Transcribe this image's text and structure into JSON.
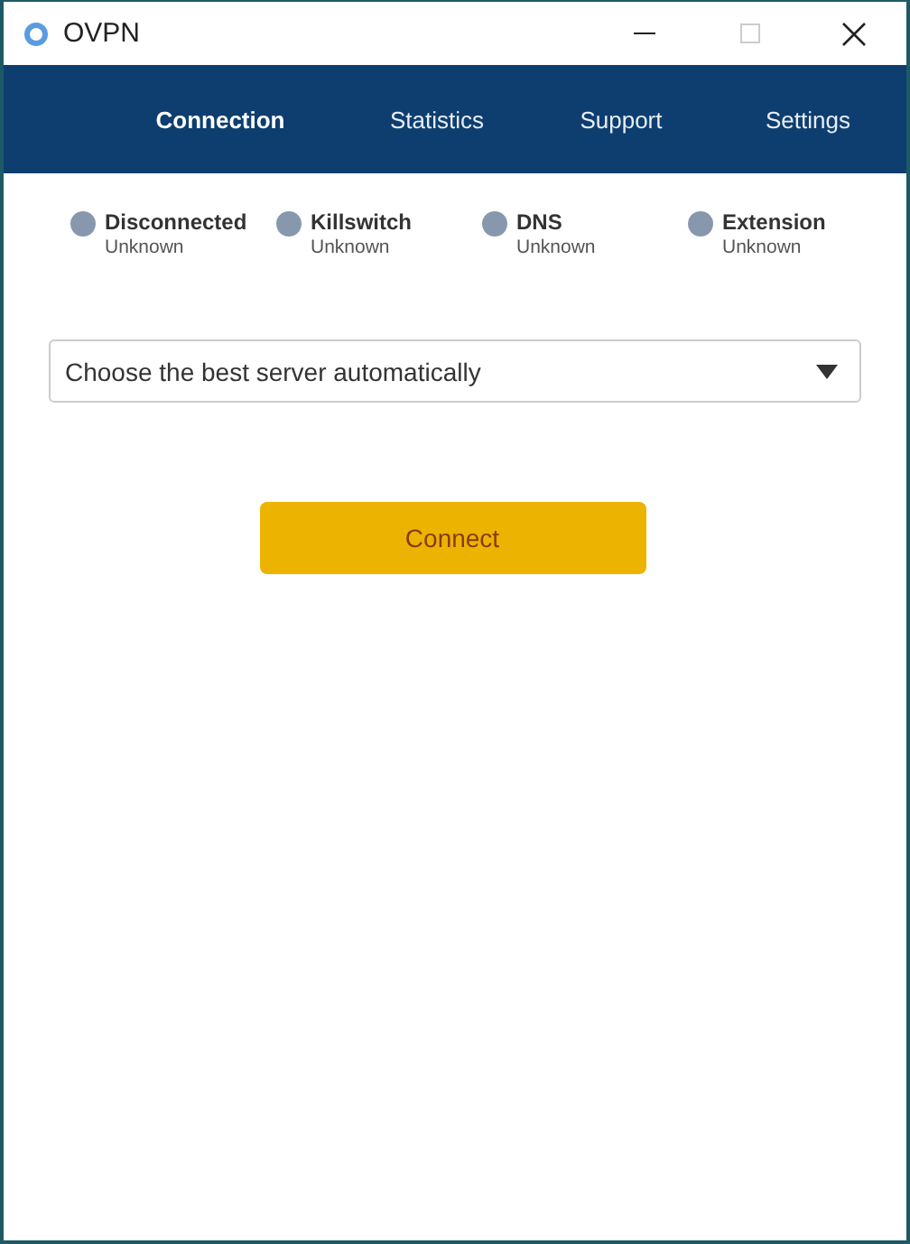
{
  "window": {
    "title": "OVPN"
  },
  "tabs": [
    {
      "label": "Connection",
      "selected": true
    },
    {
      "label": "Statistics",
      "selected": false
    },
    {
      "label": "Support",
      "selected": false
    },
    {
      "label": "Settings",
      "selected": false
    }
  ],
  "statuses": [
    {
      "name": "Disconnected",
      "value": "Unknown"
    },
    {
      "name": "Killswitch",
      "value": "Unknown"
    },
    {
      "name": "DNS",
      "value": "Unknown"
    },
    {
      "name": "Extension",
      "value": "Unknown"
    }
  ],
  "server_select": {
    "value": "Choose the best server automatically"
  },
  "connect_button": {
    "label": "Connect"
  }
}
